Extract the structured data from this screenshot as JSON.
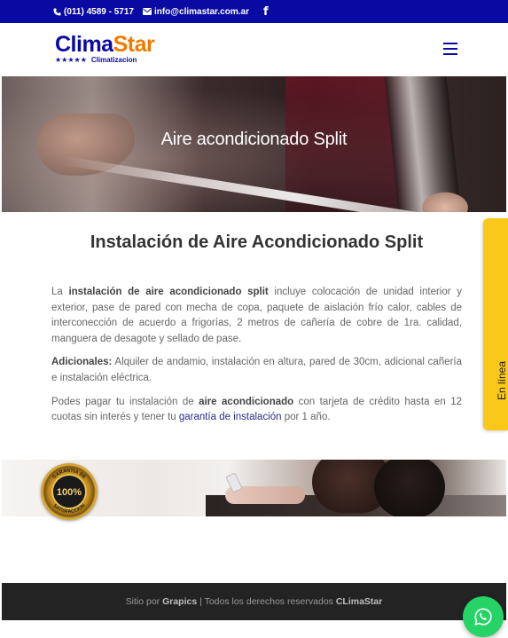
{
  "topbar": {
    "phone": "(011) 4589 - 5717",
    "email": "info@climastar.com.ar",
    "facebook": "f",
    "bg_color": "#0a0aa3"
  },
  "header": {
    "logo_part1": "Clima",
    "logo_part2": "Star",
    "logo_stars": "★★★★★",
    "logo_tagline": "Climatizacion",
    "menu_icon": "hamburger-menu-icon"
  },
  "hero": {
    "title": "Aire acondicionado Split"
  },
  "content": {
    "heading": "Instalación de Aire Acondicionado Split",
    "p1_a": "La ",
    "p1_bold": "instalación de aire acondicionado split",
    "p1_b": " incluye colocación de unidad interior y exterior, pase de pared con mecha de copa, paquete de aislación frío calor, cables de interconección de acuerdo a frigorías, 2 metros de cañería de cobre de 1ra. calidad, manguera de desagote y sellado de pase.",
    "p2_bold": "Adicionales:",
    "p2_text": " Alquiler de andamio, instalación en altura, pared de 30cm, adicional cañería e instalación eléctrica.",
    "p3_a": "Podes pagar tu instalación de ",
    "p3_bold": "aire acondicionado",
    "p3_b": " con tarjeta de crédito hasta en 12 cuotas sin interés y tener tu ",
    "p3_link": "garantía de instalación",
    "p3_c": " por 1 año."
  },
  "side_tab": {
    "label": "En línea",
    "color": "#f9c819"
  },
  "banner": {
    "seal_text": "100%",
    "seal_ring_top": "GARANTIA DE",
    "seal_ring_bottom": "SATISFACCION"
  },
  "footer": {
    "prefix": "Sitio por ",
    "author": "Grapics",
    "middle": " | Todos los derechos reservados ",
    "brand": "CLimaStar"
  },
  "whatsapp": {
    "icon": "whatsapp-icon",
    "color": "#25d366"
  }
}
